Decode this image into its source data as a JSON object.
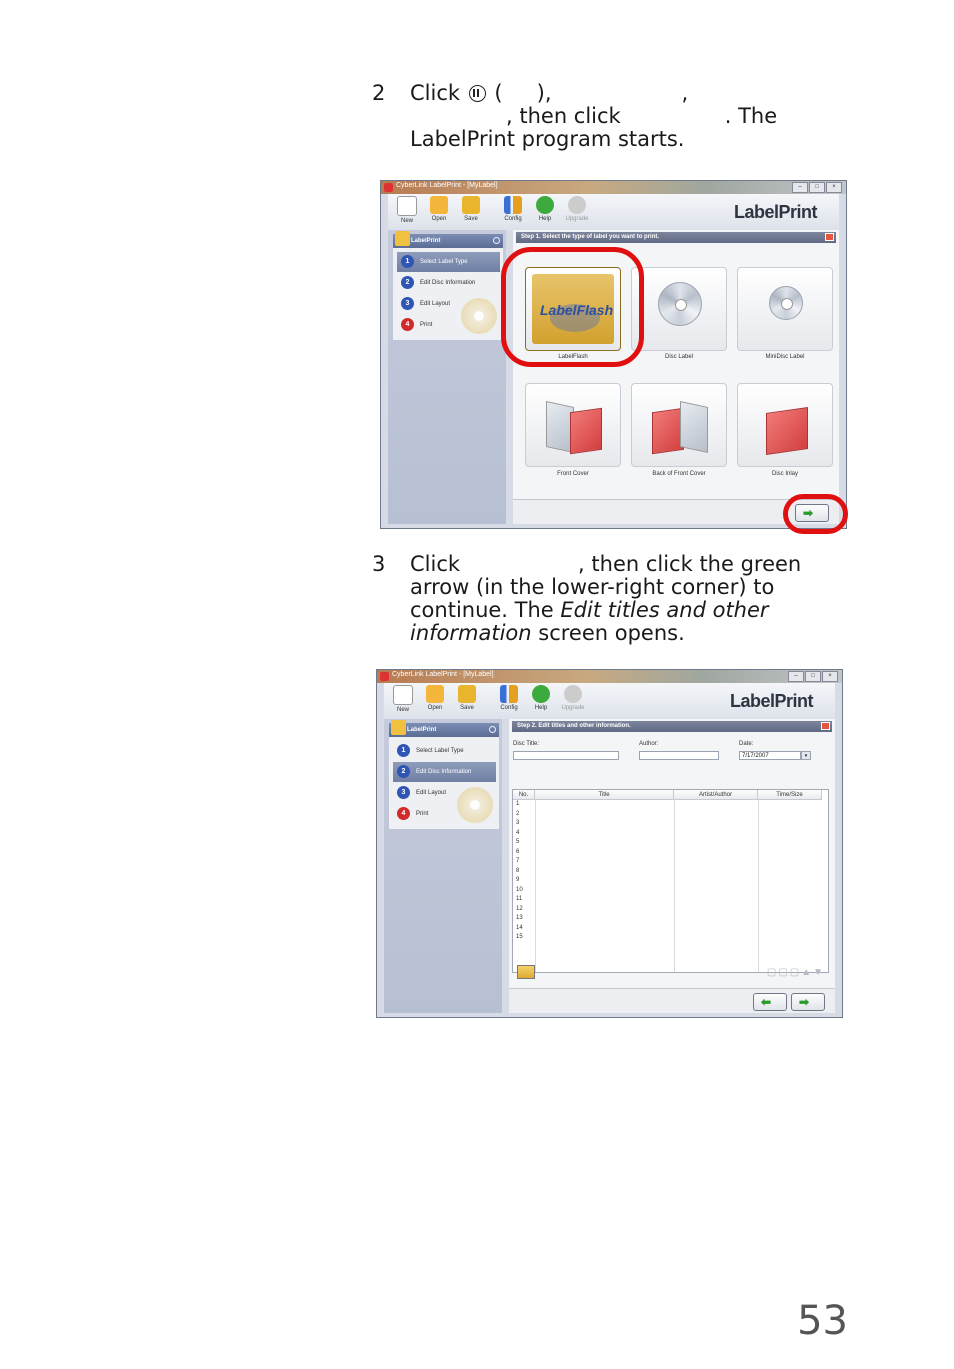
{
  "step2": {
    "num": "2",
    "l1_a": "Click",
    "l1_b": "(",
    "l1_c": "),",
    "l1_d": ",",
    "l2_a": ", then click",
    "l2_b": ". The",
    "l3": "LabelPrint program starts."
  },
  "step3": {
    "num": "3",
    "l1_a": "Click",
    "l1_b": ", then click the green",
    "l2": "arrow (in the lower-right corner) to",
    "l3_a": "continue. The",
    "l3_em": "Edit titles and other",
    "l4_em": "information",
    "l4_b": "screen opens."
  },
  "page_number": "53",
  "app": {
    "title": "CyberLink LabelPrint - [MyLabel]",
    "brand": "LabelPrint",
    "toolbar": [
      "New",
      "Open",
      "Save",
      "Config",
      "Help",
      "Upgrade"
    ],
    "side_title": "LabelPrint",
    "side_items": [
      "Select Label Type",
      "Edit Disc Information",
      "Edit Layout",
      "Print"
    ],
    "step_colors": [
      "#2f56b5",
      "#2f56b5",
      "#2f56b5",
      "#d22a2a"
    ],
    "highlight_color": "#e01010"
  },
  "shot1": {
    "header": "Step 1. Select the type of label you want to print.",
    "tiles": [
      "LabelFlash",
      "Disc Label",
      "MiniDisc Label",
      "Front Cover",
      "Back of Front Cover",
      "Disc Inlay"
    ],
    "logo_text": "LabelFlash"
  },
  "shot2": {
    "header": "Step 2. Edit titles and other information.",
    "disc_title_label": "Disc Title:",
    "author_label": "Author:",
    "date_label": "Date:",
    "date_value": "7/17/2007",
    "columns": [
      "No.",
      "Title",
      "Artist/Author",
      "Time/Size"
    ],
    "rows": [
      "1",
      "2",
      "3",
      "4",
      "5",
      "6",
      "7",
      "8",
      "9",
      "10",
      "11",
      "12",
      "13",
      "14",
      "15"
    ]
  }
}
